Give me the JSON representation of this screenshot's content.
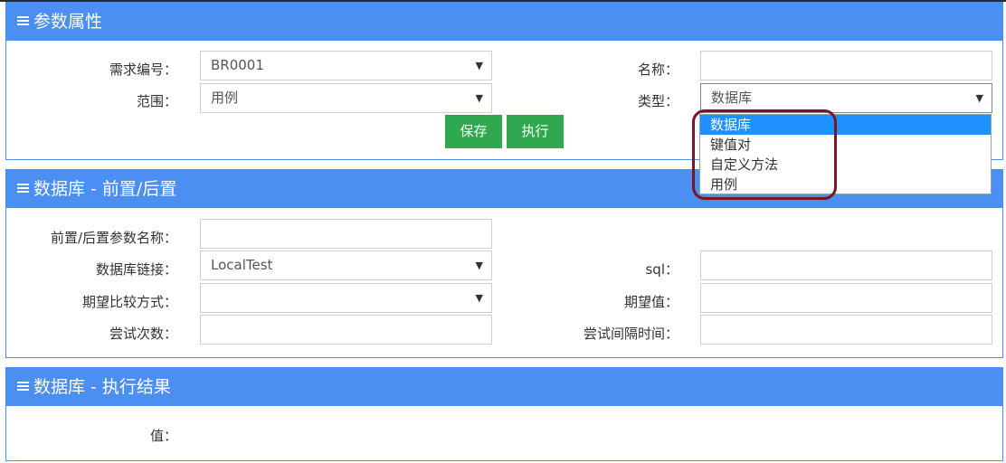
{
  "panel1": {
    "title": "参数属性",
    "req_label": "需求编号：",
    "req_value": "BR0001",
    "scope_label": "范围：",
    "scope_value": "用例",
    "name_label": "名称：",
    "name_value": "",
    "type_label": "类型：",
    "type_value": "数据库",
    "save_label": "保存",
    "run_label": "执行",
    "type_options": [
      "数据库",
      "键值对",
      "自定义方法",
      "用例"
    ]
  },
  "panel2": {
    "title": "数据库 - 前置/后置",
    "param_name_label": "前置/后置参数名称：",
    "param_name_value": "",
    "db_link_label": "数据库链接：",
    "db_link_value": "LocalTest",
    "sql_label": "sql：",
    "sql_value": "",
    "compare_label": "期望比较方式：",
    "compare_value": "",
    "expected_label": "期望值：",
    "expected_value": "",
    "retry_label": "尝试次数：",
    "retry_value": "",
    "interval_label": "尝试间隔时间：",
    "interval_value": ""
  },
  "panel3": {
    "title": "数据库 - 执行结果",
    "value_label": "值："
  },
  "colors": {
    "header": "#4b8ff2",
    "button": "#2fa84f",
    "selected_option": "#1e90ff",
    "highlight": "#7a1528"
  },
  "icons": {
    "panel_header": "menu-icon",
    "select": "caret-down-icon"
  }
}
